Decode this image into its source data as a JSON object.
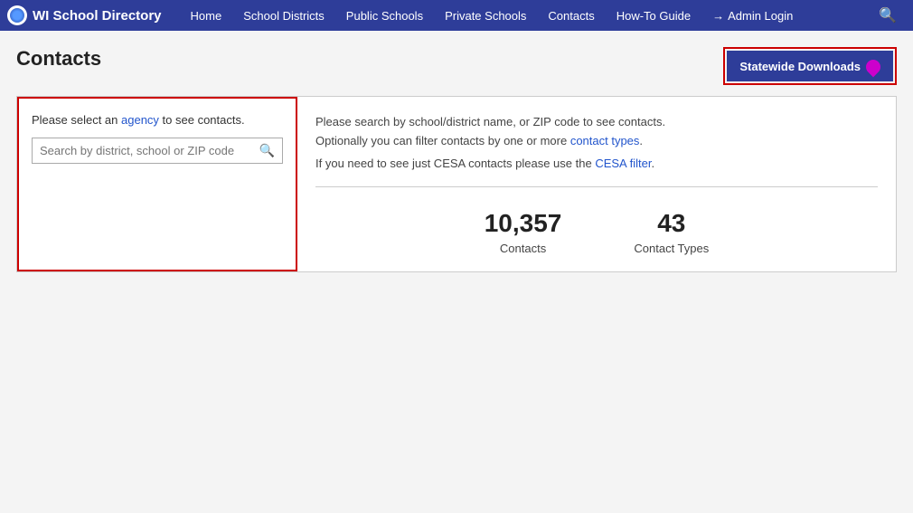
{
  "app": {
    "title": "WI School Directory"
  },
  "nav": {
    "brand": "WI School Directory",
    "links": [
      {
        "label": "Home",
        "name": "nav-home"
      },
      {
        "label": "School Districts",
        "name": "nav-school-districts"
      },
      {
        "label": "Public Schools",
        "name": "nav-public-schools"
      },
      {
        "label": "Private Schools",
        "name": "nav-private-schools"
      },
      {
        "label": "Contacts",
        "name": "nav-contacts"
      },
      {
        "label": "How-To Guide",
        "name": "nav-how-to-guide"
      },
      {
        "label": "Admin Login",
        "name": "nav-admin-login"
      }
    ]
  },
  "page": {
    "title": "Contacts",
    "statewide_btn": "Statewide Downloads"
  },
  "left_panel": {
    "agency_prompt_static": "Please select an agency to see contacts.",
    "agency_link_text": "agency",
    "search_placeholder": "Search by district, school or ZIP code"
  },
  "right_panel": {
    "desc_line1": "Please search by school/district name, or ZIP code to see contacts.",
    "desc_line2": "Optionally you can filter contacts by one or more contact types.",
    "cesa_note": "If you need to see just CESA contacts please use the CESA filter.",
    "cesa_link_text": "CESA filter"
  },
  "stats": [
    {
      "number": "10,357",
      "label": "Contacts"
    },
    {
      "number": "43",
      "label": "Contact Types"
    }
  ]
}
